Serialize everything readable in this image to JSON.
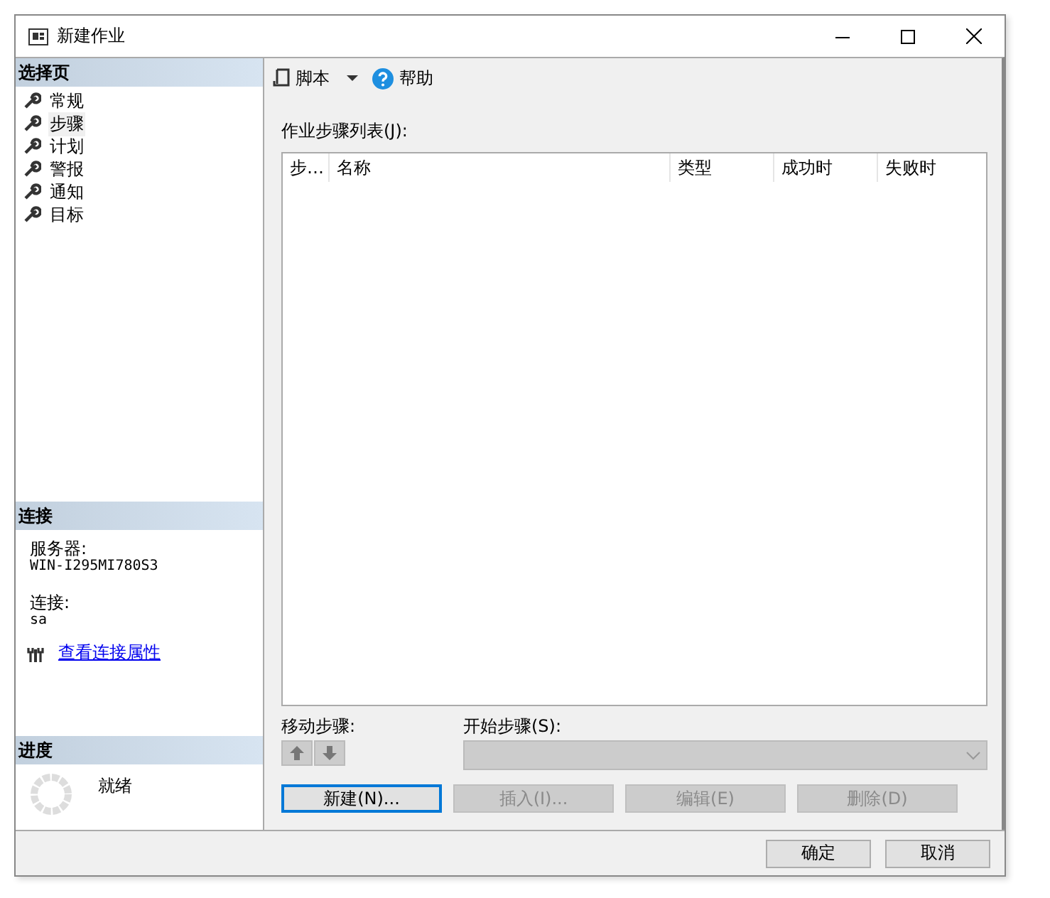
{
  "window": {
    "title": "新建作业"
  },
  "sidebar": {
    "header": "选择页",
    "items": [
      {
        "label": "常规",
        "selected": false
      },
      {
        "label": "步骤",
        "selected": true
      },
      {
        "label": "计划",
        "selected": false
      },
      {
        "label": "警报",
        "selected": false
      },
      {
        "label": "通知",
        "selected": false
      },
      {
        "label": "目标",
        "selected": false
      }
    ]
  },
  "connection": {
    "header": "连接",
    "server_label": "服务器:",
    "server": "WIN-I295MI780S3",
    "login_label": "连接:",
    "login": "sa",
    "link": "查看连接属性"
  },
  "progress": {
    "header": "进度",
    "status": "就绪"
  },
  "toolbar": [
    {
      "kind": "script",
      "label": "脚本"
    },
    {
      "kind": "help",
      "label": "帮助"
    }
  ],
  "steps_list": {
    "label": "作业步骤列表(J):",
    "columns": [
      "步…",
      "名称",
      "类型",
      "成功时",
      "失败时"
    ]
  },
  "move_steps": {
    "label": "移动步骤:",
    "disabled": true
  },
  "start_step": {
    "label": "开始步骤(S):",
    "disabled": true
  },
  "action_buttons": [
    {
      "label": "新建(N)...",
      "disabled": false,
      "focused": true
    },
    {
      "label": "插入(I)...",
      "disabled": true,
      "focused": false
    },
    {
      "label": "编辑(E)",
      "disabled": true,
      "focused": false
    },
    {
      "label": "删除(D)",
      "disabled": true,
      "focused": false
    }
  ],
  "dialog_buttons": [
    "确定",
    "取消"
  ]
}
